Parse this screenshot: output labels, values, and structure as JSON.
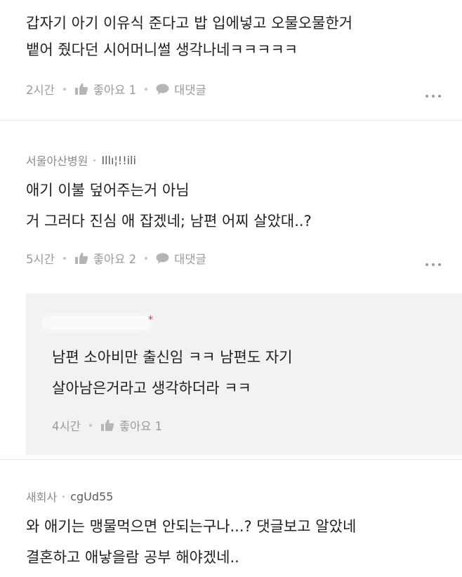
{
  "comments": [
    {
      "lines": [
        "갑자기 아기 이유식 준다고 밥 입에넣고 오물오물한거",
        "뱉어 줬다던 시어머니썰 생각나네ㅋㅋㅋㅋㅋ"
      ],
      "time": "2시간",
      "like_label": "좋아요 1",
      "reply_label": "대댓글"
    },
    {
      "author_location": "서울아산병원",
      "author_handle": "Illı¦!!ili",
      "lines": [
        "애기 이불 덮어주는거 아님",
        "거 그러다 진심 애 잡겠네; 남편 어찌 살았대..?"
      ],
      "time": "5시간",
      "like_label": "좋아요 2",
      "reply_label": "대댓글"
    },
    {
      "author_location": "새회사",
      "author_handle": "cgUd55",
      "lines": [
        "와 애기는 맹물먹으면 안되는구나...? 댓글보고 알았네",
        "결혼하고 애낳을람 공부 해야겠네.."
      ]
    }
  ],
  "reply": {
    "star": "*",
    "lines": [
      "남편 소아비만 출신임 ㅋㅋ 남편도 자기",
      "살아남은거라고 생각하더라 ㅋㅋ"
    ],
    "time": "4시간",
    "like_label": "좋아요 1"
  },
  "icons": {
    "like": "thumbs-up-icon",
    "reply": "speech-bubble-icon",
    "more": "more-dots-icon"
  },
  "colors": {
    "text": "#1f1f1f",
    "meta": "#9a9a9a",
    "reply_bg": "#f2f2f2",
    "star": "#d9373b"
  }
}
